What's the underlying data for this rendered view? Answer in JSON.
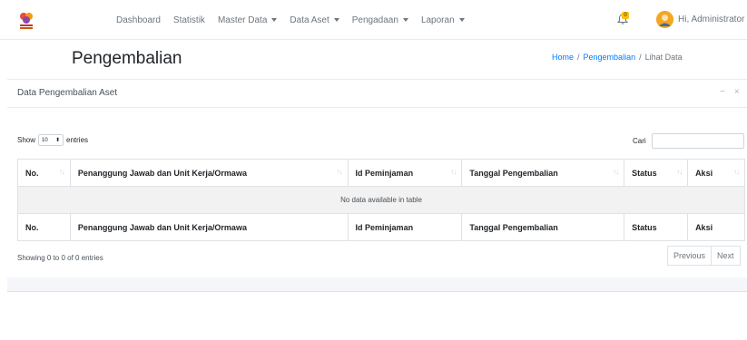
{
  "navbar": {
    "menu": [
      {
        "label": "Dashboard",
        "dropdown": false
      },
      {
        "label": "Statistik",
        "dropdown": false
      },
      {
        "label": "Master Data",
        "dropdown": true
      },
      {
        "label": "Data Aset",
        "dropdown": true
      },
      {
        "label": "Pengadaan",
        "dropdown": true
      },
      {
        "label": "Laporan",
        "dropdown": true
      }
    ],
    "notification_count": "0",
    "user_greeting": "Hi, Administrator",
    "logo_icon": "institution-logo-icon"
  },
  "page": {
    "title": "Pengembalian",
    "breadcrumb": {
      "home": "Home",
      "sep1": "/",
      "section": "Pengembalian",
      "sep2": "/",
      "current": "Lihat Data"
    }
  },
  "card": {
    "title": "Data Pengembalian Aset",
    "collapse_symbol": "−",
    "close_symbol": "×"
  },
  "table_controls": {
    "show_label": "Show",
    "length_value": "10",
    "entries_label": "entries",
    "search_label": "Cari",
    "search_value": ""
  },
  "table": {
    "columns": [
      "No.",
      "Penanggung Jawab dan Unit Kerja/Ormawa",
      "Id Peminjaman",
      "Tanggal Pengembalian",
      "Status",
      "Aksi"
    ],
    "empty_message": "No data available in table",
    "info": "Showing 0 to 0 of 0 entries"
  },
  "pagination": {
    "previous": "Previous",
    "next": "Next"
  },
  "colors": {
    "accent": "#007bff",
    "badge": "#ffc107",
    "avatar": "#f5a623"
  }
}
